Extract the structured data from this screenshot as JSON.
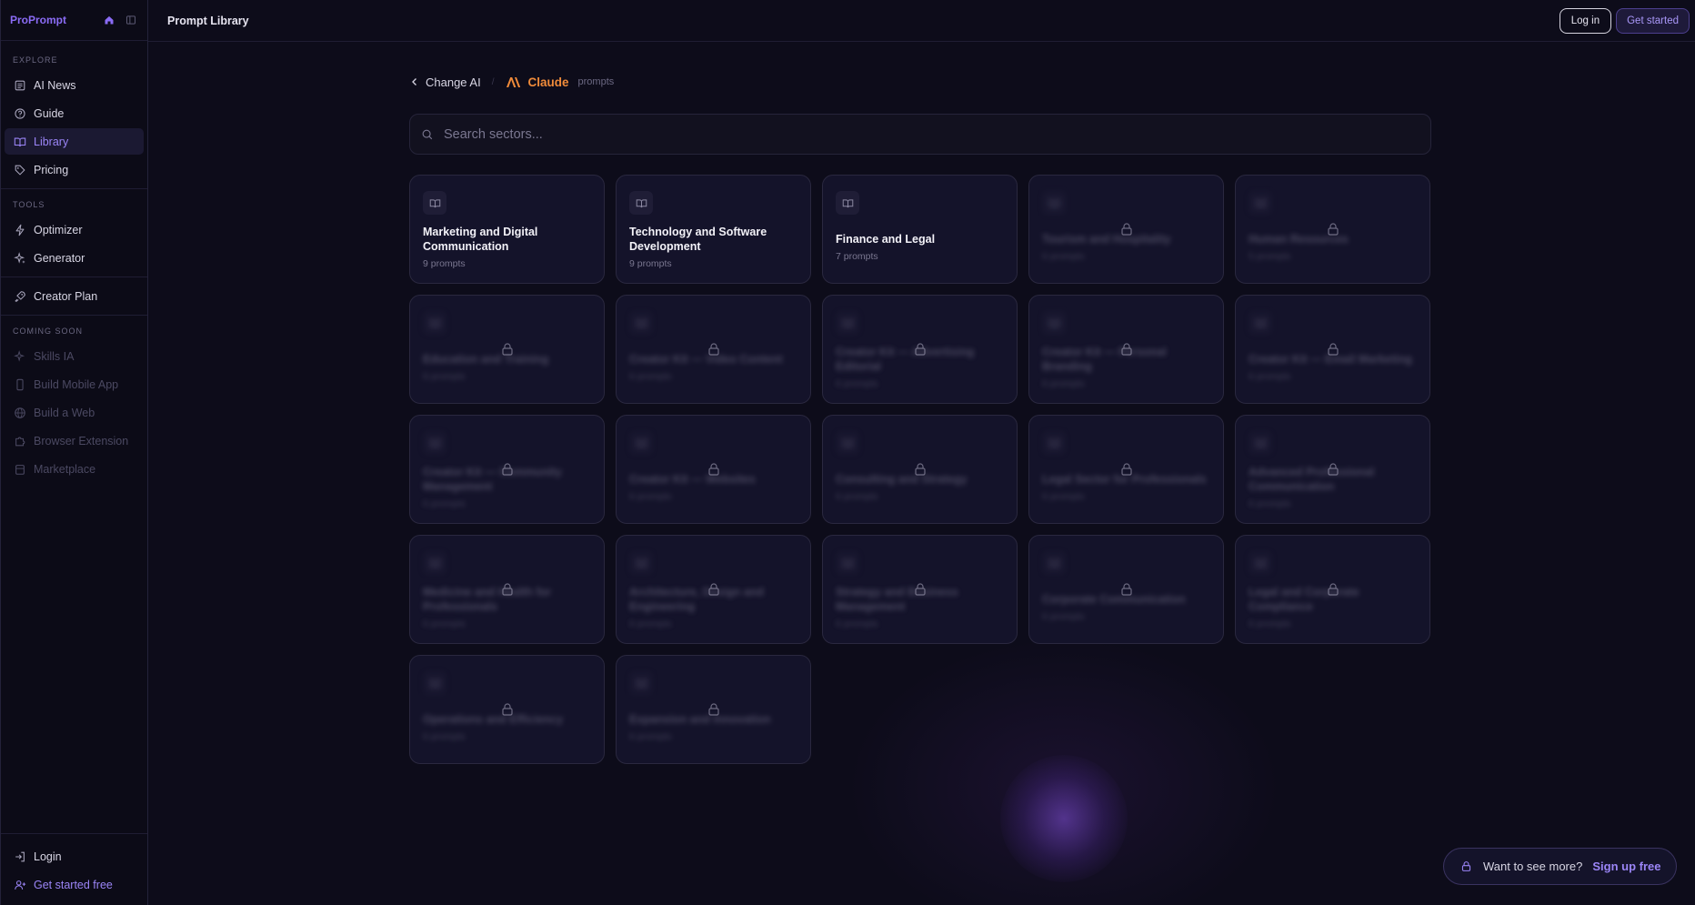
{
  "app": {
    "brand": "ProPrompt",
    "page_title": "Prompt Library"
  },
  "header": {
    "login_label": "Log in",
    "get_started_label": "Get started"
  },
  "sidebar": {
    "explore_label": "EXPLORE",
    "explore_items": [
      {
        "label": "AI News",
        "icon": "newspaper-icon"
      },
      {
        "label": "Guide",
        "icon": "help-circle-icon"
      },
      {
        "label": "Library",
        "icon": "book-open-icon",
        "active": true
      },
      {
        "label": "Pricing",
        "icon": "tag-icon"
      }
    ],
    "tools_label": "TOOLS",
    "tools_items": [
      {
        "label": "Optimizer",
        "icon": "bolt-icon"
      },
      {
        "label": "Generator",
        "icon": "sparkles-icon"
      }
    ],
    "creator_plan_label": "Creator Plan",
    "coming_soon_label": "COMING SOON",
    "coming_soon_items": [
      {
        "label": "Skills IA",
        "icon": "sparkles-icon"
      },
      {
        "label": "Build Mobile App",
        "icon": "smartphone-icon"
      },
      {
        "label": "Build a Web",
        "icon": "globe-icon"
      },
      {
        "label": "Browser Extension",
        "icon": "puzzle-icon"
      },
      {
        "label": "Marketplace",
        "icon": "store-icon"
      }
    ],
    "login_label": "Login",
    "get_started_free_label": "Get started free"
  },
  "breadcrumb": {
    "back_label": "Change AI",
    "ai_name": "Claude",
    "ai_suffix": "prompts",
    "ai_color": "#f08b3a"
  },
  "search": {
    "placeholder": "Search sectors..."
  },
  "sectors": [
    {
      "title": "Marketing and Digital Communication",
      "count": "9 prompts",
      "locked": false
    },
    {
      "title": "Technology and Software Development",
      "count": "9 prompts",
      "locked": false
    },
    {
      "title": "Finance and Legal",
      "count": "7 prompts",
      "locked": false
    },
    {
      "title": "Tourism and Hospitality",
      "count": "6 prompts",
      "locked": true
    },
    {
      "title": "Human Resources",
      "count": "5 prompts",
      "locked": true
    },
    {
      "title": "Education and Training",
      "count": "8 prompts",
      "locked": true
    },
    {
      "title": "Creator Kit — Video Content",
      "count": "6 prompts",
      "locked": true
    },
    {
      "title": "Creator Kit — Advertising Editorial",
      "count": "6 prompts",
      "locked": true
    },
    {
      "title": "Creator Kit — Personal Branding",
      "count": "6 prompts",
      "locked": true
    },
    {
      "title": "Creator Kit — Email Marketing",
      "count": "6 prompts",
      "locked": true
    },
    {
      "title": "Creator Kit — Community Management",
      "count": "6 prompts",
      "locked": true
    },
    {
      "title": "Creator Kit — Websites",
      "count": "6 prompts",
      "locked": true
    },
    {
      "title": "Consulting and Strategy",
      "count": "6 prompts",
      "locked": true
    },
    {
      "title": "Legal Sector for Professionals",
      "count": "6 prompts",
      "locked": true
    },
    {
      "title": "Advanced Professional Communication",
      "count": "6 prompts",
      "locked": true
    },
    {
      "title": "Medicine and Health for Professionals",
      "count": "6 prompts",
      "locked": true
    },
    {
      "title": "Architecture, Design and Engineering",
      "count": "6 prompts",
      "locked": true
    },
    {
      "title": "Strategy and Business Management",
      "count": "6 prompts",
      "locked": true
    },
    {
      "title": "Corporate Communication",
      "count": "6 prompts",
      "locked": true
    },
    {
      "title": "Legal and Corporate Compliance",
      "count": "6 prompts",
      "locked": true
    },
    {
      "title": "Operations and Efficiency",
      "count": "6 prompts",
      "locked": true
    },
    {
      "title": "Expansion and Innovation",
      "count": "6 prompts",
      "locked": true
    }
  ],
  "promo": {
    "question": "Want to see more?",
    "cta": "Sign up free"
  },
  "colors": {
    "accent": "#8b6cf6",
    "background": "#0d0c1a"
  }
}
